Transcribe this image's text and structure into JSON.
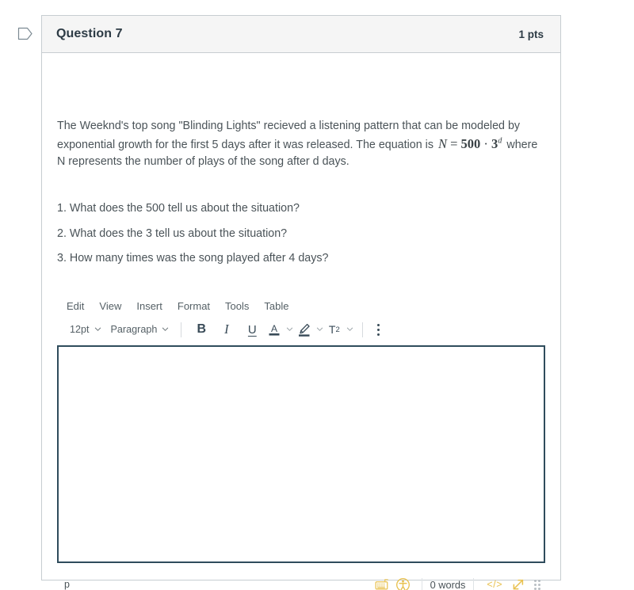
{
  "question": {
    "title": "Question 7",
    "points": "1 pts",
    "flag_icon": "flag-outline-icon",
    "prompt": {
      "part1": "The Weeknd's top song \"Blinding Lights\" recieved a listening pattern that can be modeled by exponential growth for the first 5 days after it was released. The equation is ",
      "equation": {
        "variable": "N",
        "equals": "=",
        "coefficient": "500",
        "operator": "·",
        "base": "3",
        "exponent": "d",
        "plain": "N = 500 · 3^d"
      },
      "part2": " where N represents the number of plays of the song after d days."
    },
    "sub_questions": [
      "1. What does the 500 tell us about the situation?",
      "2. What does the 3 tell us about the situation?",
      "3. How many times was the song played after 4 days?"
    ]
  },
  "editor": {
    "menubar": [
      {
        "label": "Edit"
      },
      {
        "label": "View"
      },
      {
        "label": "Insert"
      },
      {
        "label": "Format"
      },
      {
        "label": "Tools"
      },
      {
        "label": "Table"
      }
    ],
    "toolbar": {
      "font_size": "12pt",
      "block_format": "Paragraph",
      "bold": "B",
      "italic": "I",
      "underline": "U",
      "text_color": "A",
      "highlight_color": "highlight-pen-icon",
      "superscript": "T",
      "superscript_exponent": "2",
      "more_label": "more-options-kebab-icon"
    },
    "content": "",
    "placeholder": "",
    "statusbar": {
      "element_path": "p",
      "word_count": "0 words",
      "keyboard_shortcuts_icon": "keyboard-icon",
      "accessibility_icon": "accessibility-checker-icon",
      "html_editor_icon": "</>",
      "fullscreen_icon": "resize-diagonal-icon",
      "resize_grip_icon": "resize-grip-icon"
    }
  },
  "colors": {
    "header_bg": "#f5f5f5",
    "card_border": "#c7cdd1",
    "text": "#4a5358",
    "heading": "#2d3b45",
    "editor_focus_border": "#2f4c5c",
    "status_accent": "#e8c14f"
  }
}
